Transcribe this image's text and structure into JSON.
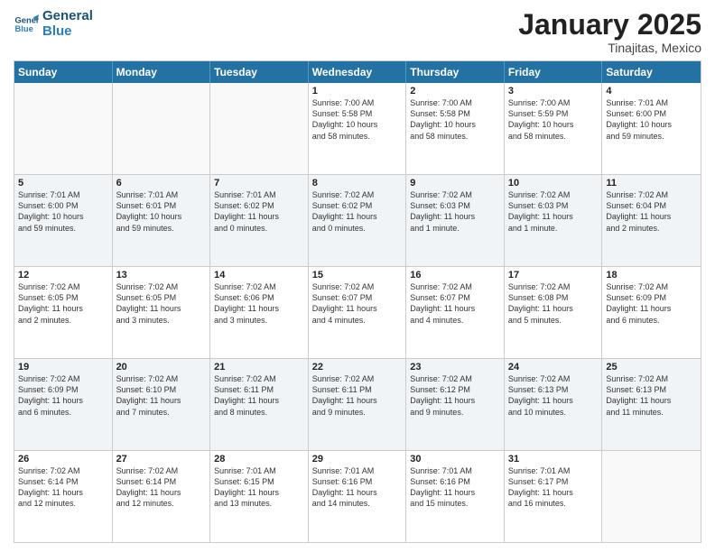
{
  "logo": {
    "line1": "General",
    "line2": "Blue"
  },
  "title": "January 2025",
  "location": "Tinajitas, Mexico",
  "header_days": [
    "Sunday",
    "Monday",
    "Tuesday",
    "Wednesday",
    "Thursday",
    "Friday",
    "Saturday"
  ],
  "weeks": [
    [
      {
        "day": "",
        "info": ""
      },
      {
        "day": "",
        "info": ""
      },
      {
        "day": "",
        "info": ""
      },
      {
        "day": "1",
        "info": "Sunrise: 7:00 AM\nSunset: 5:58 PM\nDaylight: 10 hours\nand 58 minutes."
      },
      {
        "day": "2",
        "info": "Sunrise: 7:00 AM\nSunset: 5:58 PM\nDaylight: 10 hours\nand 58 minutes."
      },
      {
        "day": "3",
        "info": "Sunrise: 7:00 AM\nSunset: 5:59 PM\nDaylight: 10 hours\nand 58 minutes."
      },
      {
        "day": "4",
        "info": "Sunrise: 7:01 AM\nSunset: 6:00 PM\nDaylight: 10 hours\nand 59 minutes."
      }
    ],
    [
      {
        "day": "5",
        "info": "Sunrise: 7:01 AM\nSunset: 6:00 PM\nDaylight: 10 hours\nand 59 minutes."
      },
      {
        "day": "6",
        "info": "Sunrise: 7:01 AM\nSunset: 6:01 PM\nDaylight: 10 hours\nand 59 minutes."
      },
      {
        "day": "7",
        "info": "Sunrise: 7:01 AM\nSunset: 6:02 PM\nDaylight: 11 hours\nand 0 minutes."
      },
      {
        "day": "8",
        "info": "Sunrise: 7:02 AM\nSunset: 6:02 PM\nDaylight: 11 hours\nand 0 minutes."
      },
      {
        "day": "9",
        "info": "Sunrise: 7:02 AM\nSunset: 6:03 PM\nDaylight: 11 hours\nand 1 minute."
      },
      {
        "day": "10",
        "info": "Sunrise: 7:02 AM\nSunset: 6:03 PM\nDaylight: 11 hours\nand 1 minute."
      },
      {
        "day": "11",
        "info": "Sunrise: 7:02 AM\nSunset: 6:04 PM\nDaylight: 11 hours\nand 2 minutes."
      }
    ],
    [
      {
        "day": "12",
        "info": "Sunrise: 7:02 AM\nSunset: 6:05 PM\nDaylight: 11 hours\nand 2 minutes."
      },
      {
        "day": "13",
        "info": "Sunrise: 7:02 AM\nSunset: 6:05 PM\nDaylight: 11 hours\nand 3 minutes."
      },
      {
        "day": "14",
        "info": "Sunrise: 7:02 AM\nSunset: 6:06 PM\nDaylight: 11 hours\nand 3 minutes."
      },
      {
        "day": "15",
        "info": "Sunrise: 7:02 AM\nSunset: 6:07 PM\nDaylight: 11 hours\nand 4 minutes."
      },
      {
        "day": "16",
        "info": "Sunrise: 7:02 AM\nSunset: 6:07 PM\nDaylight: 11 hours\nand 4 minutes."
      },
      {
        "day": "17",
        "info": "Sunrise: 7:02 AM\nSunset: 6:08 PM\nDaylight: 11 hours\nand 5 minutes."
      },
      {
        "day": "18",
        "info": "Sunrise: 7:02 AM\nSunset: 6:09 PM\nDaylight: 11 hours\nand 6 minutes."
      }
    ],
    [
      {
        "day": "19",
        "info": "Sunrise: 7:02 AM\nSunset: 6:09 PM\nDaylight: 11 hours\nand 6 minutes."
      },
      {
        "day": "20",
        "info": "Sunrise: 7:02 AM\nSunset: 6:10 PM\nDaylight: 11 hours\nand 7 minutes."
      },
      {
        "day": "21",
        "info": "Sunrise: 7:02 AM\nSunset: 6:11 PM\nDaylight: 11 hours\nand 8 minutes."
      },
      {
        "day": "22",
        "info": "Sunrise: 7:02 AM\nSunset: 6:11 PM\nDaylight: 11 hours\nand 9 minutes."
      },
      {
        "day": "23",
        "info": "Sunrise: 7:02 AM\nSunset: 6:12 PM\nDaylight: 11 hours\nand 9 minutes."
      },
      {
        "day": "24",
        "info": "Sunrise: 7:02 AM\nSunset: 6:13 PM\nDaylight: 11 hours\nand 10 minutes."
      },
      {
        "day": "25",
        "info": "Sunrise: 7:02 AM\nSunset: 6:13 PM\nDaylight: 11 hours\nand 11 minutes."
      }
    ],
    [
      {
        "day": "26",
        "info": "Sunrise: 7:02 AM\nSunset: 6:14 PM\nDaylight: 11 hours\nand 12 minutes."
      },
      {
        "day": "27",
        "info": "Sunrise: 7:02 AM\nSunset: 6:14 PM\nDaylight: 11 hours\nand 12 minutes."
      },
      {
        "day": "28",
        "info": "Sunrise: 7:01 AM\nSunset: 6:15 PM\nDaylight: 11 hours\nand 13 minutes."
      },
      {
        "day": "29",
        "info": "Sunrise: 7:01 AM\nSunset: 6:16 PM\nDaylight: 11 hours\nand 14 minutes."
      },
      {
        "day": "30",
        "info": "Sunrise: 7:01 AM\nSunset: 6:16 PM\nDaylight: 11 hours\nand 15 minutes."
      },
      {
        "day": "31",
        "info": "Sunrise: 7:01 AM\nSunset: 6:17 PM\nDaylight: 11 hours\nand 16 minutes."
      },
      {
        "day": "",
        "info": ""
      }
    ]
  ]
}
